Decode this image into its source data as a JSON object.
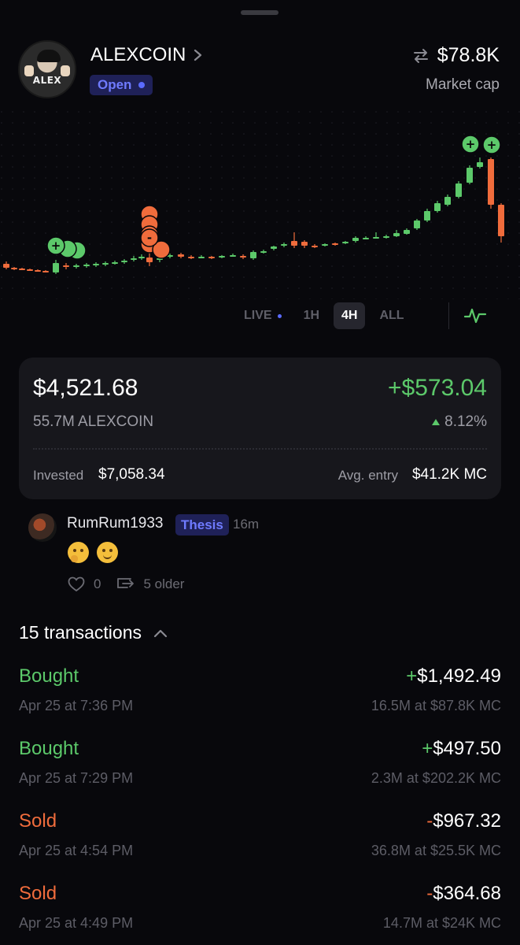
{
  "header": {
    "avatar_text": "ALEX",
    "coin_name": "ALEXCOIN",
    "status": "Open",
    "market_cap_value": "$78.8K",
    "market_cap_label": "Market cap"
  },
  "chart": {
    "type": "candlestick",
    "up_color": "#5cc96a",
    "down_color": "#f06c3c",
    "buy_marker_symbol": "+",
    "sell_marker_symbol": "-"
  },
  "timeframes": [
    {
      "label": "LIVE",
      "active": false
    },
    {
      "label": "1H",
      "active": false
    },
    {
      "label": "4H",
      "active": true
    },
    {
      "label": "ALL",
      "active": false
    }
  ],
  "position": {
    "value": "$4,521.68",
    "pnl": "+$573.04",
    "holding": "55.7M ALEXCOIN",
    "pnl_pct": "8.12%",
    "invested_label": "Invested",
    "invested_value": "$7,058.34",
    "avg_entry_label": "Avg. entry",
    "avg_entry_value": "$41.2K MC"
  },
  "comment": {
    "username": "RumRum1933",
    "tag": "Thesis",
    "time": "16m",
    "emojis": [
      "thinking-face",
      "smiling-face"
    ],
    "likes": "0",
    "older": "5 older"
  },
  "transactions": {
    "header": "15 transactions",
    "items": [
      {
        "type": "Bought",
        "sign": "+",
        "amount": "$1,492.49",
        "date": "Apr 25 at 7:36 PM",
        "detail": "16.5M at $87.8K MC"
      },
      {
        "type": "Bought",
        "sign": "+",
        "amount": "$497.50",
        "date": "Apr 25 at 7:29 PM",
        "detail": "2.3M at $202.2K MC"
      },
      {
        "type": "Sold",
        "sign": "-",
        "amount": "$967.32",
        "date": "Apr 25 at 4:54 PM",
        "detail": "36.8M at $25.5K MC"
      },
      {
        "type": "Sold",
        "sign": "-",
        "amount": "$364.68",
        "date": "Apr 25 at 4:49 PM",
        "detail": "14.7M at $24K MC"
      }
    ]
  },
  "colors": {
    "accent_blue": "#5b6bff",
    "green": "#5cc96a",
    "orange": "#f06c3c",
    "background": "#08080c",
    "card": "#17171c"
  }
}
